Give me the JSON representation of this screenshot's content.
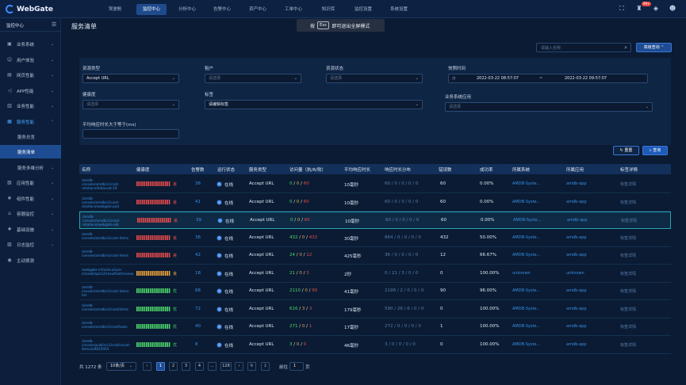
{
  "app": {
    "name": "WebGate"
  },
  "nav": [
    "驾驶舱",
    "监控中心",
    "分析中心",
    "告警中心",
    "资产中心",
    "工单中心",
    "知识库",
    "监控设置",
    "系统设置"
  ],
  "top": {
    "badge": "99+"
  },
  "sidebar": {
    "title": "监控中心",
    "items": [
      {
        "label": "业务系统",
        "icon": "▣"
      },
      {
        "label": "用户体验",
        "icon": "☺"
      },
      {
        "label": "网页性能",
        "icon": "▤"
      },
      {
        "label": "APP性能",
        "icon": "◁"
      },
      {
        "label": "业务性能",
        "icon": "▥"
      },
      {
        "label": "服务性能",
        "icon": "▦"
      },
      {
        "label": "服务总览",
        "icon": ""
      },
      {
        "label": "服务清单",
        "icon": ""
      },
      {
        "label": "服务多维分析",
        "icon": ""
      },
      {
        "label": "应用性能",
        "icon": "▧"
      },
      {
        "label": "组件性能",
        "icon": "❖"
      },
      {
        "label": "容器监控",
        "icon": "⌂"
      },
      {
        "label": "基础设施",
        "icon": "✚"
      },
      {
        "label": "日志监控",
        "icon": "▨"
      },
      {
        "label": "主动拨测",
        "icon": "◉"
      }
    ]
  },
  "page": {
    "title": "服务清单"
  },
  "toast": {
    "pre": "按",
    "key": "Esc",
    "post": "即可退出全屏模式"
  },
  "search": {
    "placeholder": "请输入名称",
    "advanced": "高级查询"
  },
  "filters": {
    "resource_type": {
      "label": "资源类型",
      "value": "Accept URL"
    },
    "tenant": {
      "label": "租户",
      "placeholder": "请选择"
    },
    "resource_status": {
      "label": "资源状态",
      "placeholder": "请选择"
    },
    "time": {
      "label": "快照时间",
      "start": "2022-03-22 08:57:07",
      "sep": "~",
      "end": "2022-03-22 09:57:07"
    },
    "health": {
      "label": "健康度",
      "placeholder": "请选择"
    },
    "tag": {
      "label": "标签",
      "placeholder": "请编辑标签"
    },
    "business_app": {
      "label": "业务系统应用",
      "placeholder": "请选择"
    },
    "avg_resp": {
      "label": "平均响应时长大于等于(ms)",
      "value": ""
    },
    "reset": "重置",
    "query": "查询"
  },
  "table": {
    "headers": [
      "名称",
      "健康度",
      "告警数",
      "运行状态",
      "服务类型",
      "访问量（执/R/败）",
      "平均响应时长",
      "响应时长分布",
      "错误数",
      "成功率",
      "所属系统",
      "所属应用",
      "标签详情"
    ],
    "rows": [
      {
        "name": "/amdb-console/amdb/v1/cost-relations/datacost-19",
        "health": "差",
        "hc": "r",
        "alarms": "36",
        "status": "在线",
        "type": "Accept URL",
        "v1": "0",
        "v2": "0",
        "v3": "60",
        "avg": "10毫秒",
        "dist": "60 / 0 / 0 / 0 / 0",
        "errors": "60",
        "rate": "0.00%",
        "system": "AMDB-Syste...",
        "app": "amdb-app",
        "tag": "标签详情"
      },
      {
        "name": "/amdb-console/amdb/v1/cost-relations/webgate-pod",
        "health": "差",
        "hc": "r",
        "alarms": "41",
        "status": "在线",
        "type": "Accept URL",
        "v1": "0",
        "v2": "0",
        "v3": "60",
        "avg": "10毫秒",
        "dist": "60 / 0 / 0 / 0 / 0",
        "errors": "60",
        "rate": "0.00%",
        "system": "AMDB-Syste...",
        "app": "amdb-app",
        "tag": "标签详情"
      },
      {
        "name": "/amdb-console/amdb/v1/cost-relations/webgate-aib",
        "health": "差",
        "hc": "r",
        "alarms": "39",
        "status": "在线",
        "type": "Accept URL",
        "v1": "0",
        "v2": "0",
        "v3": "60",
        "avg": "10毫秒",
        "dist": "60 / 0 / 0 / 0 / 0",
        "errors": "60",
        "rate": "0.00%",
        "system": "AMDB-Syste...",
        "app": "amdb-app",
        "tag": "标签详情"
      },
      {
        "name": "/amdb-console/amdb/v1/cost-items",
        "health": "差",
        "hc": "r",
        "alarms": "36",
        "status": "在线",
        "type": "Accept URL",
        "v1": "432",
        "v2": "0",
        "v3": "432",
        "avg": "30毫秒",
        "dist": "864 / 0 / 0 / 0 / 0",
        "errors": "432",
        "rate": "50.00%",
        "system": "AMDB-Syste...",
        "app": "amdb-app",
        "tag": "标签详情"
      },
      {
        "name": "/amdb-console/amdb/v1/cost-items",
        "health": "差",
        "hc": "r",
        "alarms": "42",
        "status": "在线",
        "type": "Accept URL",
        "v1": "24",
        "v2": "0",
        "v3": "12",
        "avg": "425毫秒",
        "dist": "36 / 0 / 0 / 0 / 0",
        "errors": "12",
        "rate": "66.67%",
        "system": "AMDB-Syste...",
        "app": "amdb-app",
        "tag": "标签详情"
      },
      {
        "name": "/webgate-infrastructure-cmodel/api/v2/resultSet/review",
        "health": "良",
        "hc": "o",
        "alarms": "18",
        "status": "在线",
        "type": "Accept URL",
        "v1": "21",
        "v2": "0",
        "v3": "3",
        "avg": "2秒",
        "dist": "0 / 21 / 3 / 0 / 0",
        "errors": "0",
        "rate": "100.00%",
        "system": "unknown",
        "app": "unknown",
        "tag": "标签详情"
      },
      {
        "name": "/amdb-console/amdb/v1/cost-items-list",
        "health": "优",
        "hc": "g",
        "alarms": "88",
        "status": "在线",
        "type": "Accept URL",
        "v1": "2110",
        "v2": "0",
        "v3": "90",
        "avg": "41毫秒",
        "dist": "2198 / 2 / 0 / 0 / 0",
        "errors": "90",
        "rate": "96.00%",
        "system": "AMDB-Syste...",
        "app": "amdb-app",
        "tag": "标签详情"
      },
      {
        "name": "/amdb-console/amdb/v2/cost/items",
        "health": "优",
        "hc": "g",
        "alarms": "72",
        "status": "在线",
        "type": "Accept URL",
        "v1": "616",
        "v2": "3",
        "v3": "3",
        "avg": "179毫秒",
        "dist": "590 / 26 / 6 / 0 / 0",
        "errors": "0",
        "rate": "100.00%",
        "system": "AMDB-Syste...",
        "app": "amdb-app",
        "tag": "标签详情"
      },
      {
        "name": "/amdb-console/amdb/v1/cost/tools",
        "health": "优",
        "hc": "g",
        "alarms": "40",
        "status": "在线",
        "type": "Accept URL",
        "v1": "271",
        "v2": "0",
        "v3": "1",
        "avg": "17毫秒",
        "dist": "272 / 0 / 0 / 0 / 0",
        "errors": "1",
        "rate": "100.00%",
        "system": "AMDB-Syste...",
        "app": "amdb-app",
        "tag": "标签详情"
      },
      {
        "name": "/amdb-console/public/v1/cost/count-items/a9825903",
        "health": "优",
        "hc": "g",
        "alarms": "8",
        "status": "在线",
        "type": "Accept URL",
        "v1": "3",
        "v2": "0",
        "v3": "0",
        "avg": "46毫秒",
        "dist": "3 / 0 / 0 / 0 / 0",
        "errors": "0",
        "rate": "100.00%",
        "system": "AMDB-Syste...",
        "app": "amdb-app",
        "tag": "标签详情"
      }
    ]
  },
  "pager": {
    "total": "共 1272 条",
    "per_page": "10条/页",
    "pages": [
      "1",
      "2",
      "3",
      "4",
      "...",
      "128"
    ],
    "goto_label": "前往",
    "goto_value": "1",
    "goto_suffix": "页"
  },
  "colors": {
    "good": "#4ed86a",
    "ok": "#f0a33a",
    "bad": "#e54b4b",
    "accent": "#1e4c93"
  }
}
